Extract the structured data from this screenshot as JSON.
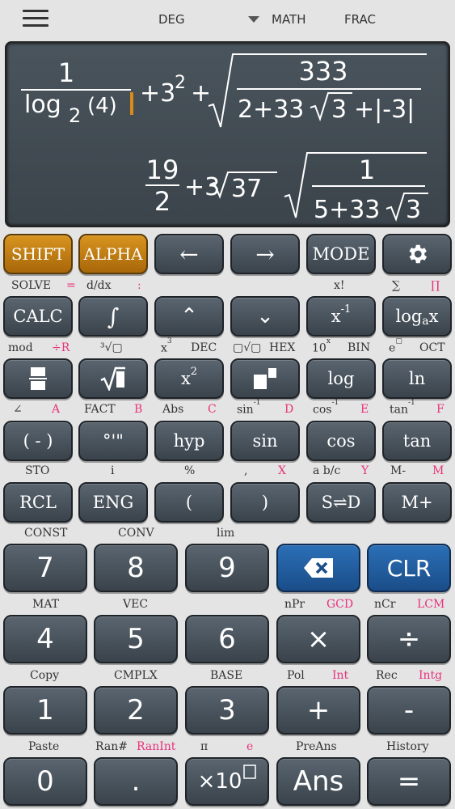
{
  "topbar": {
    "deg": "DEG",
    "math": "MATH",
    "frac": "FRAC"
  },
  "display": {
    "line1": {
      "num": "1",
      "log": "log",
      "log_base": "2",
      "log_arg": "(4)",
      "plus1": "+3",
      "exp": "2",
      "plus2": "+",
      "root_num": "333",
      "root_den_a": "2+33",
      "root_den_b": "3",
      "root_den_c": "+|-3|"
    },
    "line2": {
      "num": "19",
      "den": "2",
      "mid": "+3",
      "sqrt_arg": "37",
      "root_num": "1",
      "root_den_a": "5+33",
      "root_den_b": "3"
    }
  },
  "row1": {
    "shift": "SHIFT",
    "alpha": "ALPHA",
    "left": "←",
    "right": "→",
    "mode": "MODE"
  },
  "labels1": {
    "solve": "SOLVE",
    "eq": "=",
    "ddx": "d/dx",
    "colon": ":",
    "fact": "x!",
    "sum": "∑",
    "prod": "∏"
  },
  "row2": {
    "calc": "CALC",
    "integral": "∫",
    "up": "⌃",
    "down": "⌄",
    "inv": "x",
    "inv_sup": "-1",
    "log": "log",
    "log_sub": "a",
    "log_x": "x"
  },
  "labels2": {
    "mod": "mod",
    "divr": "÷R",
    "cbrt": "³√▢",
    "cube": "x",
    "cube_sup": "3",
    "dec": "DEC",
    "xroot": "▢√▢",
    "hex": "HEX",
    "ten": "10",
    "ten_sup": "x",
    "bin": "BIN",
    "e": "e",
    "e_sup": "▢",
    "oct": "OCT"
  },
  "row3": {
    "square": "x",
    "square_sup": "2",
    "log": "log",
    "ln": "ln"
  },
  "labels3": {
    "angle": "∠",
    "a": "A",
    "fact2": "FACT",
    "b": "B",
    "abs": "Abs",
    "c": "C",
    "sin_inv": "sin",
    "sin_sup": "-1",
    "d": "D",
    "cos_inv": "cos",
    "cos_sup": "-1",
    "e2": "E",
    "tan_inv": "tan",
    "tan_sup": "-1",
    "f": "F"
  },
  "row4": {
    "neg": "( - )",
    "deg": "°'\"",
    "hyp": "hyp",
    "sin": "sin",
    "cos": "cos",
    "tan": "tan"
  },
  "labels4": {
    "sto": "STO",
    "i": "i",
    "pct": "%",
    "comma": ",",
    "x": "X",
    "abc": "a b/c",
    "y": "Y",
    "mminus": "M-",
    "m": "M"
  },
  "row5": {
    "rcl": "RCL",
    "eng": "ENG",
    "lpar": "(",
    "rpar": ")",
    "sd": "S⇌D",
    "mplus": "M+"
  },
  "labels5": {
    "const": "CONST",
    "conv": "CONV",
    "lim": "lim"
  },
  "row6": {
    "seven": "7",
    "eight": "8",
    "nine": "9",
    "clr": "CLR"
  },
  "labels6": {
    "mat": "MAT",
    "vec": "VEC",
    "npr": "nPr",
    "gcd": "GCD",
    "ncr": "nCr",
    "lcm": "LCM"
  },
  "row7": {
    "four": "4",
    "five": "5",
    "six": "6",
    "mul": "×",
    "div": "÷"
  },
  "labels7": {
    "copy": "Copy",
    "cmplx": "CMPLX",
    "base": "BASE",
    "pol": "Pol",
    "int": "Int",
    "rec": "Rec",
    "intg": "Intg"
  },
  "row8": {
    "one": "1",
    "two": "2",
    "three": "3",
    "plus": "+",
    "minus": "-"
  },
  "labels8": {
    "paste": "Paste",
    "ran": "Ran#",
    "ranint": "RanInt",
    "pi": "π",
    "e": "e",
    "preans": "PreAns",
    "history": "History"
  },
  "row9": {
    "zero": "0",
    "dot": ".",
    "exp": "×10",
    "ans": "Ans",
    "eq": "="
  }
}
